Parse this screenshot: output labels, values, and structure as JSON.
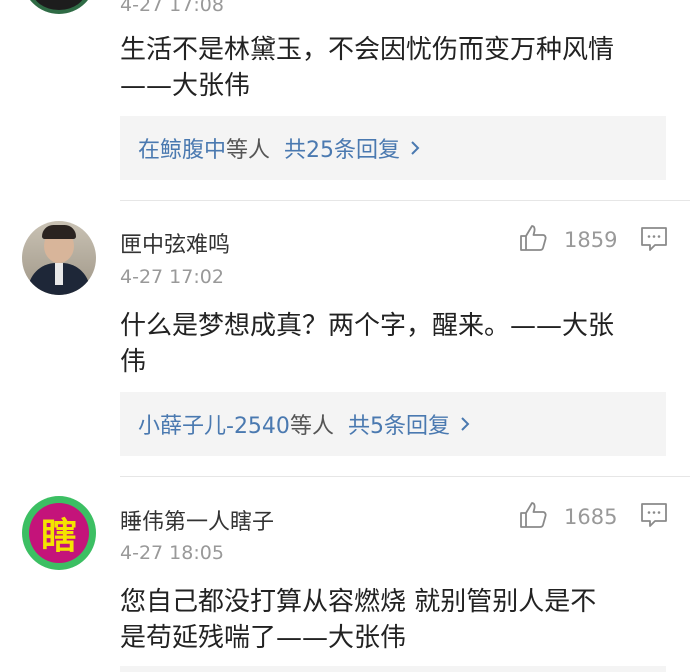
{
  "comments": [
    {
      "username": "",
      "time": "4-27 17:08",
      "text_lines": [
        "生活不是林黛玉，不会因忧伤而变万种风情",
        "——大张伟"
      ],
      "replies": {
        "names": "在鲸腹中",
        "suffix": "等人",
        "count_label": "共25条回复"
      }
    },
    {
      "username": "匣中弦难鸣",
      "time": "4-27 17:02",
      "likes": "1859",
      "text_lines": [
        "什么是梦想成真？两个字，醒来。——大张",
        "伟"
      ],
      "replies": {
        "names": "小薛子儿-2540",
        "suffix": "等人",
        "count_label": "共5条回复"
      }
    },
    {
      "username": "睡伟第一人瞎子",
      "time": "4-27 18:05",
      "likes": "1685",
      "avatar_text": "瞎",
      "text_lines": [
        "您自己都没打算从容燃烧 就别管别人是不",
        "是苟延残喘了——大张伟"
      ]
    }
  ],
  "icons": {
    "like": "thumbs-up-icon",
    "reply": "comment-bubble-icon",
    "chevron": "chevron-right-icon"
  },
  "colors": {
    "link_blue": "#4a79b0",
    "muted_gray": "#999999",
    "reply_bg": "#f4f4f4",
    "avatar_green": "#3cbf63",
    "avatar_magenta": "#c4137a"
  }
}
